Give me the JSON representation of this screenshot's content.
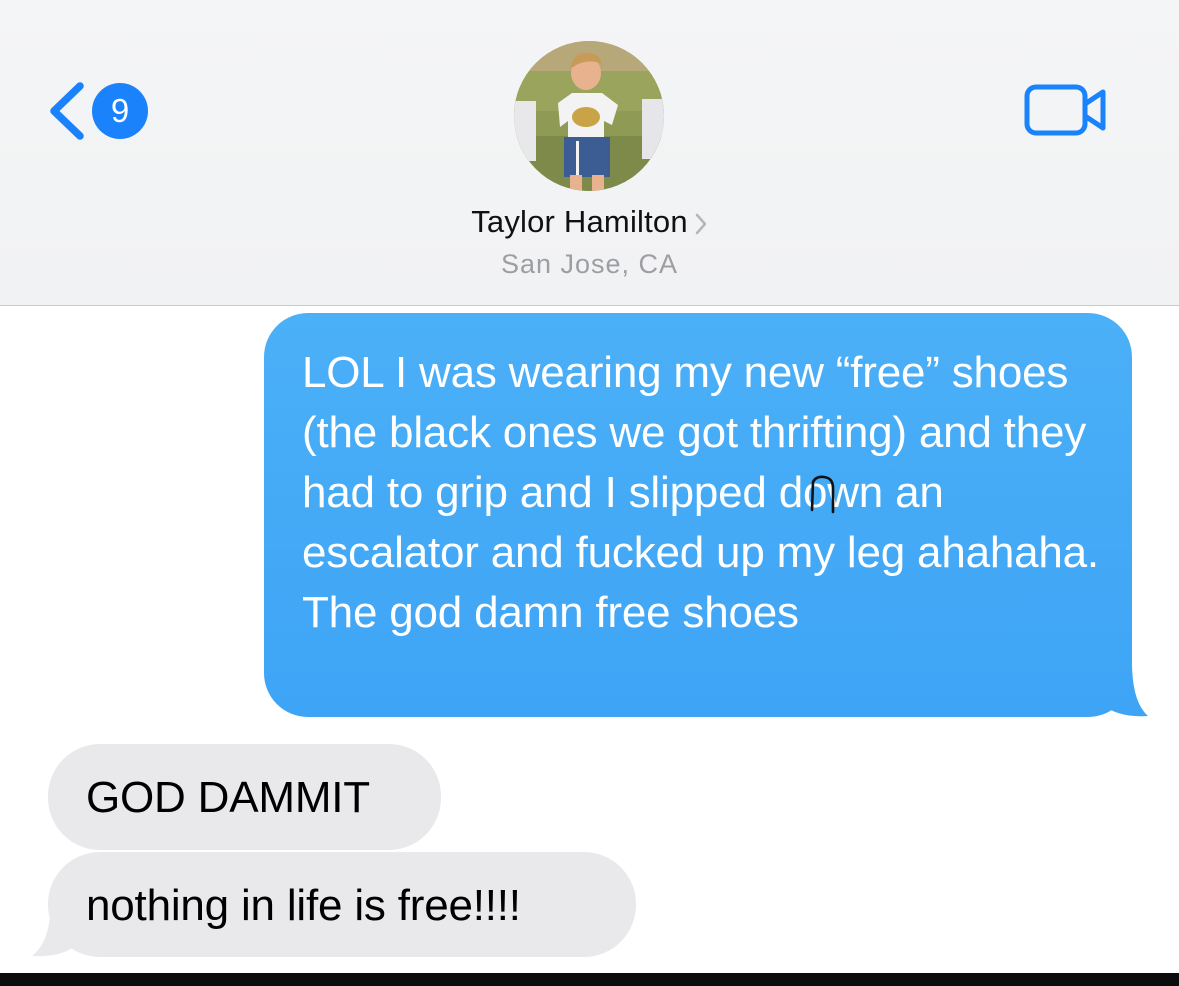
{
  "header": {
    "back_badge_count": "9",
    "contact_name": "Taylor Hamilton",
    "contact_location": "San Jose, CA",
    "icons": {
      "back": "chevron-left-icon",
      "name_disclosure": "chevron-right-icon",
      "video_call": "video-camera-icon"
    }
  },
  "messages": [
    {
      "direction": "sent",
      "text": "LOL I was wearing my new “free” shoes (the black ones we got thrifting) and they had to grip and I slipped down an escalator and fucked up my leg ahahaha. The god damn free shoes"
    },
    {
      "direction": "received",
      "text": "GOD DAMMIT"
    },
    {
      "direction": "received",
      "text": "nothing in life is free!!!!"
    }
  ],
  "colors": {
    "accent": "#1a82fb",
    "sent_bubble": "#3ea4f6",
    "received_bubble": "#e9e9eb",
    "header_bg": "#f3f4f5"
  }
}
